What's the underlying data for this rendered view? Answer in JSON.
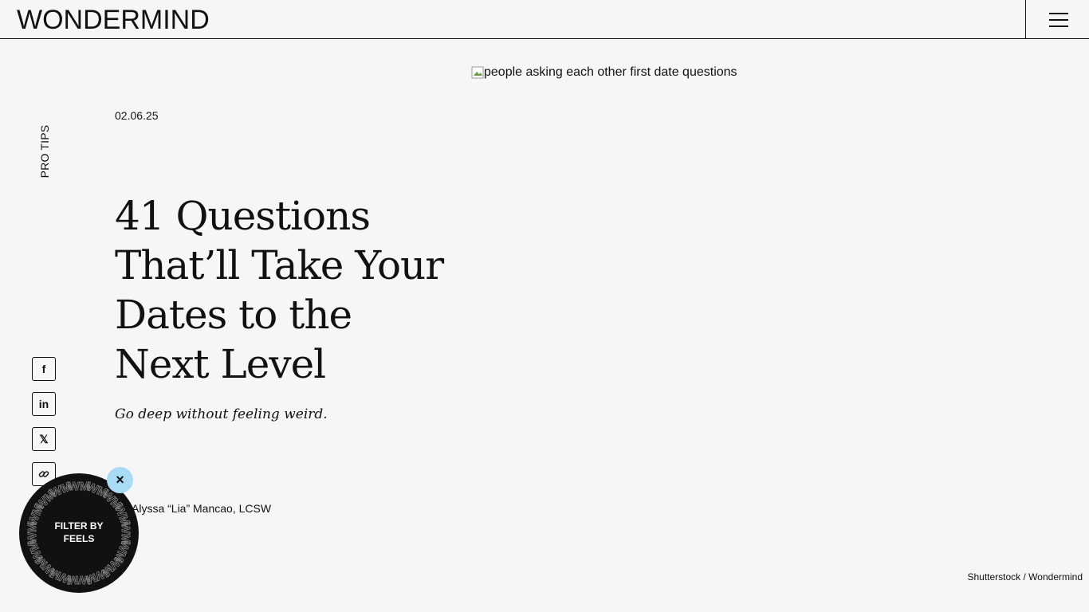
{
  "header": {
    "logo_text": "WONDERMIND",
    "menu_icon": "hamburger-icon"
  },
  "hero": {
    "image_alt": "people asking each other first date questions",
    "credit": "Shutterstock / Wondermind"
  },
  "article": {
    "category": "PRO TIPS",
    "date": "02.06.25",
    "title": "41 Questions That’ll Take Your Dates to the Next Level",
    "subtitle": "Go deep without feeling weird.",
    "author": "Alyssa “Lia” Mancao, LCSW"
  },
  "share": {
    "facebook": "f",
    "linkedin": "in",
    "x": "𝕏",
    "link_icon": "link-icon"
  },
  "filter": {
    "label_line1": "FILTER BY",
    "label_line2": "FEELS",
    "ring_text": "WM",
    "close_label": "×"
  },
  "colors": {
    "background": "#f6f6f6",
    "text": "#111111",
    "close_button": "#a9dbf6"
  }
}
